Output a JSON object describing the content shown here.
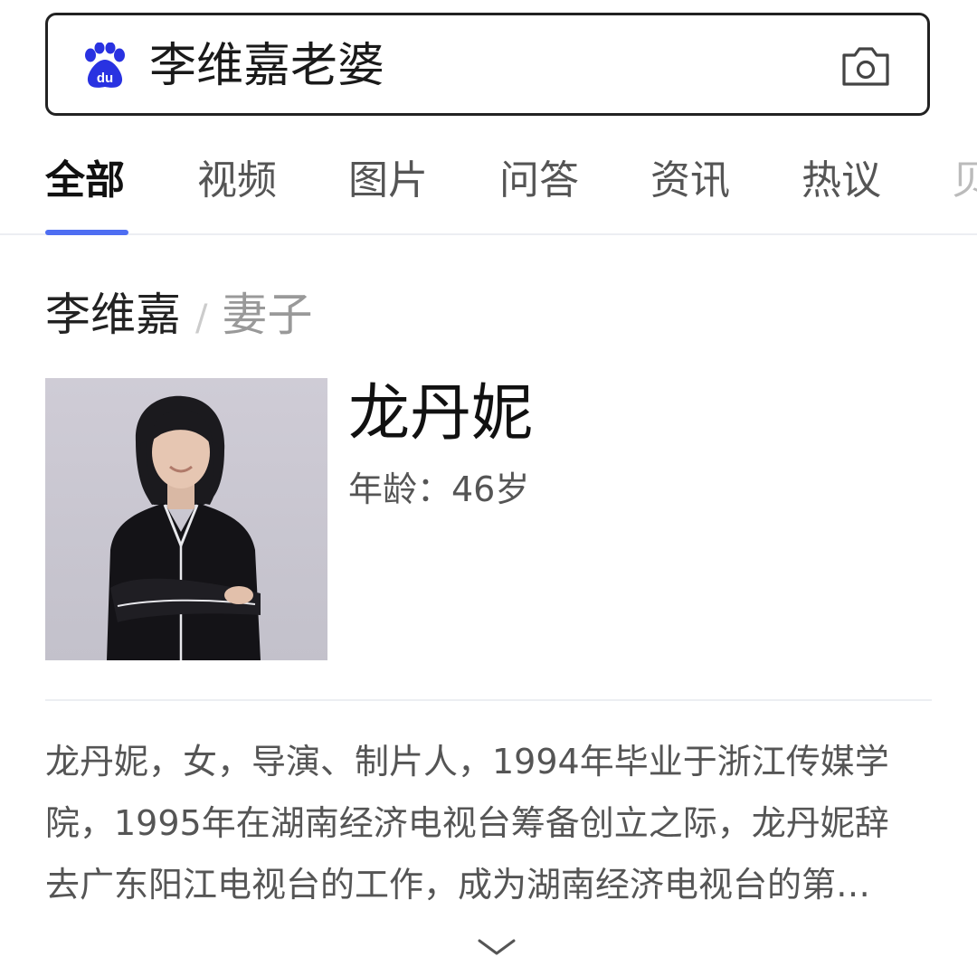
{
  "search": {
    "query": "李维嘉老婆",
    "logo_icon": "baidu-paw-icon",
    "camera_icon": "camera-icon"
  },
  "tabs": [
    {
      "label": "全部",
      "active": true
    },
    {
      "label": "视频",
      "active": false
    },
    {
      "label": "图片",
      "active": false
    },
    {
      "label": "问答",
      "active": false
    },
    {
      "label": "资讯",
      "active": false
    },
    {
      "label": "热议",
      "active": false
    },
    {
      "label": "贝",
      "active": false
    }
  ],
  "result": {
    "subject": "李维嘉",
    "separator": "/",
    "relation": "妻子",
    "name": "龙丹妮",
    "age": "年龄：46岁",
    "description_lines": [
      "龙丹妮，女，导演、制片人，1994年毕业于浙江传媒学",
      "院，1995年在湖南经济电视台筹备创立之际，龙丹妮辞",
      "去广东阳江电视台的工作，成为湖南经济电视台的第…"
    ],
    "expand_icon": "chevron-down-icon"
  },
  "colors": {
    "accent": "#4e6ef2",
    "baidu_blue": "#2932e1",
    "text_primary": "#222222",
    "text_secondary": "#555555",
    "text_muted": "#999999"
  }
}
